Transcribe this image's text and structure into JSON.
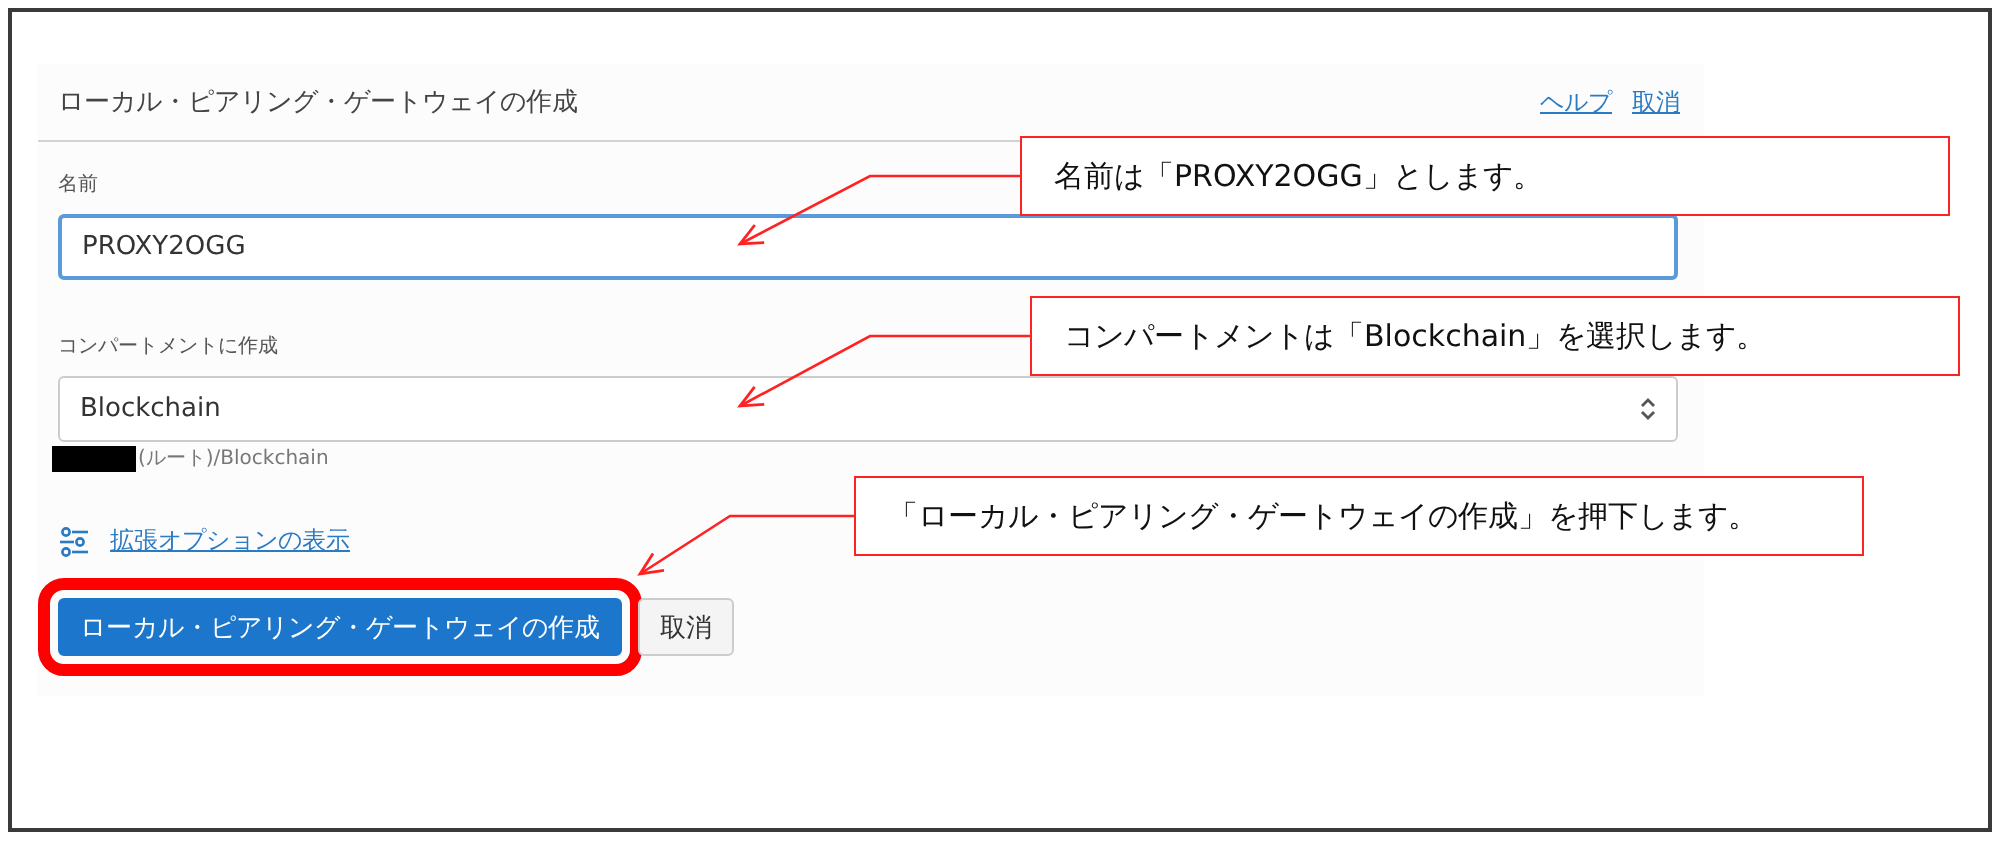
{
  "header": {
    "title": "ローカル・ピアリング・ゲートウェイの作成",
    "links": [
      {
        "label": "ヘルプ"
      },
      {
        "label": "取消"
      }
    ]
  },
  "name_field": {
    "label": "名前",
    "value": "PROXY2OGG",
    "focused": true
  },
  "compartment_field": {
    "label": "コンパートメントに作成",
    "value": "Blockchain",
    "path": "(ルート)/Blockchain"
  },
  "advanced_link": {
    "label": "拡張オプションの表示"
  },
  "buttons": [
    {
      "label": "ローカル・ピアリング・ゲートウェイの作成",
      "kind": "primary",
      "highlighted": true
    },
    {
      "label": "取消",
      "kind": "secondary",
      "highlighted": false
    }
  ],
  "annotations": [
    {
      "text": "名前は「PROXY2OGG」とします。"
    },
    {
      "text": "コンパートメントは「Blockchain」を選択します。"
    },
    {
      "text": "「ローカル・ピアリング・ゲートウェイの作成」を押下します。"
    }
  ]
}
